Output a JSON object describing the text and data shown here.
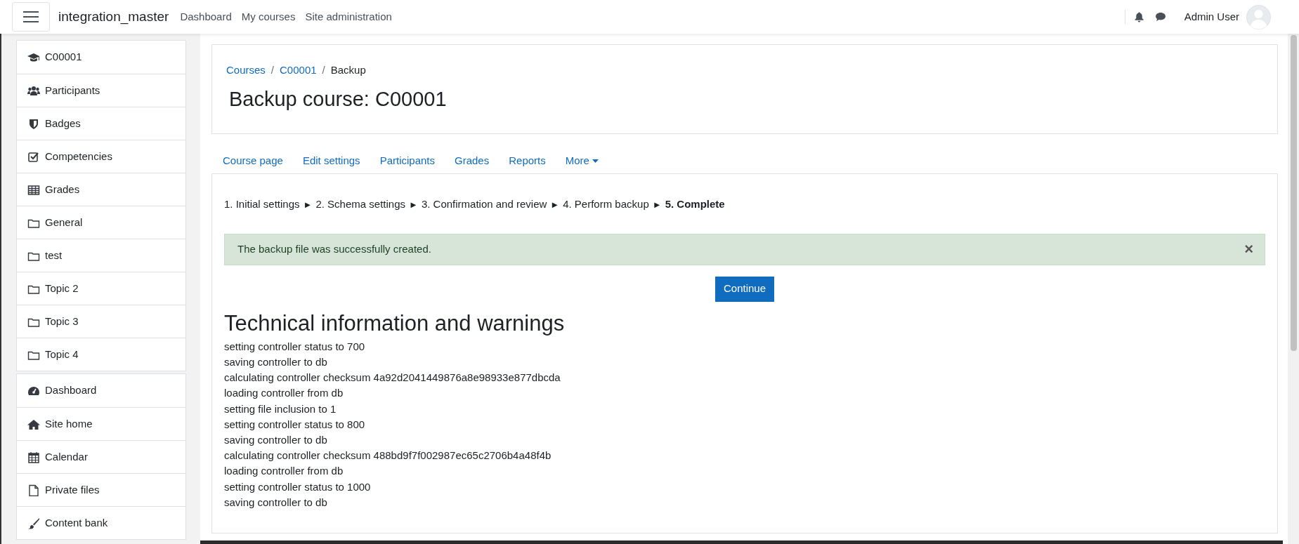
{
  "navbar": {
    "site_name": "integration_master",
    "links": [
      "Dashboard",
      "My courses",
      "Site administration"
    ],
    "user_name": "Admin User"
  },
  "sidebar": {
    "groups": [
      [
        {
          "label": "C00001"
        },
        {
          "label": "Participants"
        },
        {
          "label": "Badges"
        },
        {
          "label": "Competencies"
        },
        {
          "label": "Grades"
        },
        {
          "label": "General"
        },
        {
          "label": "test"
        },
        {
          "label": "Topic 2"
        },
        {
          "label": "Topic 3"
        },
        {
          "label": "Topic 4"
        }
      ],
      [
        {
          "label": "Dashboard"
        },
        {
          "label": "Site home"
        },
        {
          "label": "Calendar"
        },
        {
          "label": "Private files"
        },
        {
          "label": "Content bank"
        }
      ]
    ]
  },
  "breadcrumb_separators": [
    "/",
    "/"
  ],
  "breadcrumb": [
    {
      "label": "Courses",
      "link": true
    },
    {
      "label": "C00001",
      "link": true
    },
    {
      "label": "Backup",
      "link": false
    }
  ],
  "page_title": "Backup course: C00001",
  "course_tabs": [
    {
      "label": "Course page",
      "dropdown": false
    },
    {
      "label": "Edit settings",
      "dropdown": false
    },
    {
      "label": "Participants",
      "dropdown": false
    },
    {
      "label": "Grades",
      "dropdown": false
    },
    {
      "label": "Reports",
      "dropdown": false
    },
    {
      "label": "More",
      "dropdown": true
    }
  ],
  "steps": [
    {
      "label": "1. Initial settings",
      "current": false
    },
    {
      "label": "2. Schema settings",
      "current": false
    },
    {
      "label": "3. Confirmation and review",
      "current": false
    },
    {
      "label": "4. Perform backup",
      "current": false
    },
    {
      "label": "5. Complete",
      "current": true
    }
  ],
  "step_separator": "►",
  "alert": {
    "message": "The backup file was successfully created.",
    "close": "×"
  },
  "continue_button": "Continue",
  "section_heading": "Technical information and warnings",
  "log_lines": [
    "setting controller status to 700",
    "saving controller to db",
    "calculating controller checksum 4a92d2041449876a8e98933e877dbcda",
    "loading controller from db",
    "setting file inclusion to 1",
    "setting controller status to 800",
    "saving controller to db",
    "calculating controller checksum 488bd9f7f002987ec65c2706b4a48f4b",
    "loading controller from db",
    "setting controller status to 1000",
    "saving controller to db"
  ]
}
